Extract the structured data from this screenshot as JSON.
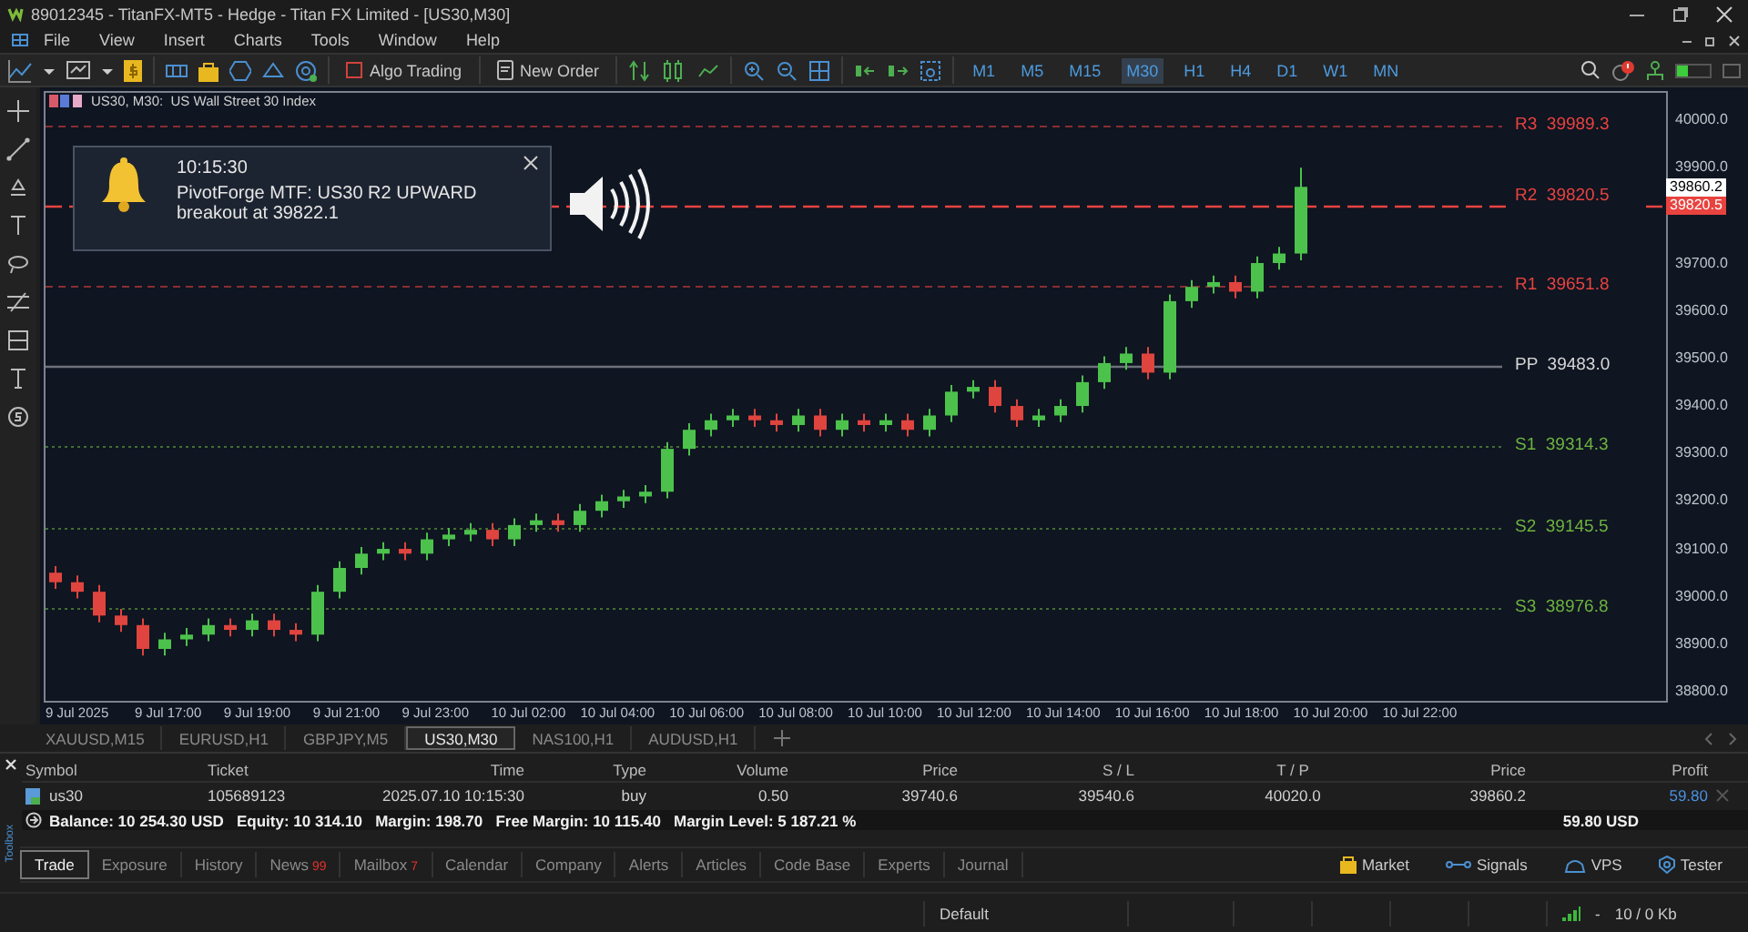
{
  "window": {
    "title": "89012345 - TitanFX-MT5 - Hedge - Titan FX Limited - [US30,M30]"
  },
  "menu": [
    "File",
    "View",
    "Insert",
    "Charts",
    "Tools",
    "Window",
    "Help"
  ],
  "toolbar": {
    "buttons": [
      {
        "label": "Algo Trading",
        "kind": "algo"
      },
      {
        "label": "New Order",
        "kind": "order"
      }
    ],
    "timeframes": [
      {
        "label": "M1",
        "selected": false
      },
      {
        "label": "M5",
        "selected": false
      },
      {
        "label": "M15",
        "selected": false
      },
      {
        "label": "M30",
        "selected": true
      },
      {
        "label": "H1",
        "selected": false
      },
      {
        "label": "H4",
        "selected": false
      },
      {
        "label": "D1",
        "selected": false
      },
      {
        "label": "W1",
        "selected": false
      },
      {
        "label": "MN",
        "selected": false
      }
    ]
  },
  "chart": {
    "header": "US30, M30:  US Wall Street 30 Index",
    "alert": {
      "time": "10:15:30",
      "message": "PivotForge MTF: US30 R2 UPWARD breakout at 39822.1"
    },
    "pivots": [
      {
        "label": "R3",
        "value": "39989.3",
        "color": "#e8433f",
        "kind": "resistance",
        "triggered": false
      },
      {
        "label": "R2",
        "value": "39820.5",
        "color": "#e8433f",
        "kind": "resistance",
        "triggered": true
      },
      {
        "label": "R1",
        "value": "39651.8",
        "color": "#e8433f",
        "kind": "resistance",
        "triggered": false
      },
      {
        "label": "PP",
        "value": "39483.0",
        "color": "#d8d8d8",
        "kind": "pivot",
        "triggered": false
      },
      {
        "label": "S1",
        "value": "39314.3",
        "color": "#6db33f",
        "kind": "support",
        "triggered": false
      },
      {
        "label": "S2",
        "value": "39145.5",
        "color": "#6db33f",
        "kind": "support",
        "triggered": false
      },
      {
        "label": "S3",
        "value": "38976.8",
        "color": "#6db33f",
        "kind": "support",
        "triggered": false
      }
    ],
    "price_axis": [
      "40000.0",
      "39900.0",
      "39700.0",
      "39600.0",
      "39500.0",
      "39400.0",
      "39300.0",
      "39200.0",
      "39100.0",
      "39000.0",
      "38900.0",
      "38800.0"
    ],
    "price_tags": [
      {
        "value": "39860.2",
        "kind": "bid"
      },
      {
        "value": "39820.5",
        "kind": "alert"
      }
    ],
    "time_axis": [
      "9 Jul 2025",
      "9 Jul 17:00",
      "9 Jul 19:00",
      "9 Jul 21:00",
      "9 Jul 23:00",
      "10 Jul 02:00",
      "10 Jul 04:00",
      "10 Jul 06:00",
      "10 Jul 08:00",
      "10 Jul 10:00",
      "10 Jul 12:00",
      "10 Jul 14:00",
      "10 Jul 16:00",
      "10 Jul 18:00",
      "10 Jul 20:00",
      "10 Jul 22:00"
    ]
  },
  "chart_tabs": [
    {
      "label": "XAUUSD,M15",
      "selected": false
    },
    {
      "label": "EURUSD,H1",
      "selected": false
    },
    {
      "label": "GBPJPY,M5",
      "selected": false
    },
    {
      "label": "US30,M30",
      "selected": true
    },
    {
      "label": "NAS100,H1",
      "selected": false
    },
    {
      "label": "AUDUSD,H1",
      "selected": false
    }
  ],
  "trade": {
    "columns": [
      "Symbol",
      "Ticket",
      "Time",
      "Type",
      "Volume",
      "Price",
      "S / L",
      "T / P",
      "Price",
      "Profit"
    ],
    "rows": [
      {
        "cells": [
          "us30",
          "105689123",
          "2025.07.10 10:15:30",
          "buy",
          "0.50",
          "39740.6",
          "39540.6",
          "40020.0",
          "39860.2",
          "59.80"
        ]
      }
    ],
    "summary": "Balance: 10 254.30 USD   Equity: 10 314.10   Margin: 198.70   Free Margin: 10 115.40   Margin Level: 5 187.21 %",
    "total": "59.80 USD"
  },
  "toolbox_label": "Toolbox",
  "tabs": [
    {
      "label": "Trade",
      "selected": true
    },
    {
      "label": "Exposure",
      "selected": false
    },
    {
      "label": "History",
      "selected": false
    },
    {
      "label": "News",
      "badge": "99",
      "selected": false
    },
    {
      "label": "Mailbox",
      "badge": "7",
      "selected": false
    },
    {
      "label": "Calendar",
      "selected": false
    },
    {
      "label": "Company",
      "selected": false
    },
    {
      "label": "Alerts",
      "selected": false
    },
    {
      "label": "Articles",
      "selected": false
    },
    {
      "label": "Code Base",
      "selected": false
    },
    {
      "label": "Experts",
      "selected": false
    },
    {
      "label": "Journal",
      "selected": false
    }
  ],
  "services": [
    {
      "label": "Market",
      "kind": "market"
    },
    {
      "label": "Signals",
      "kind": "signals"
    },
    {
      "label": "VPS",
      "kind": "vps"
    },
    {
      "label": "Tester",
      "kind": "tester"
    }
  ],
  "status_bar": {
    "profile": "Default",
    "ping": "-",
    "traffic": "10 / 0 Kb"
  }
}
